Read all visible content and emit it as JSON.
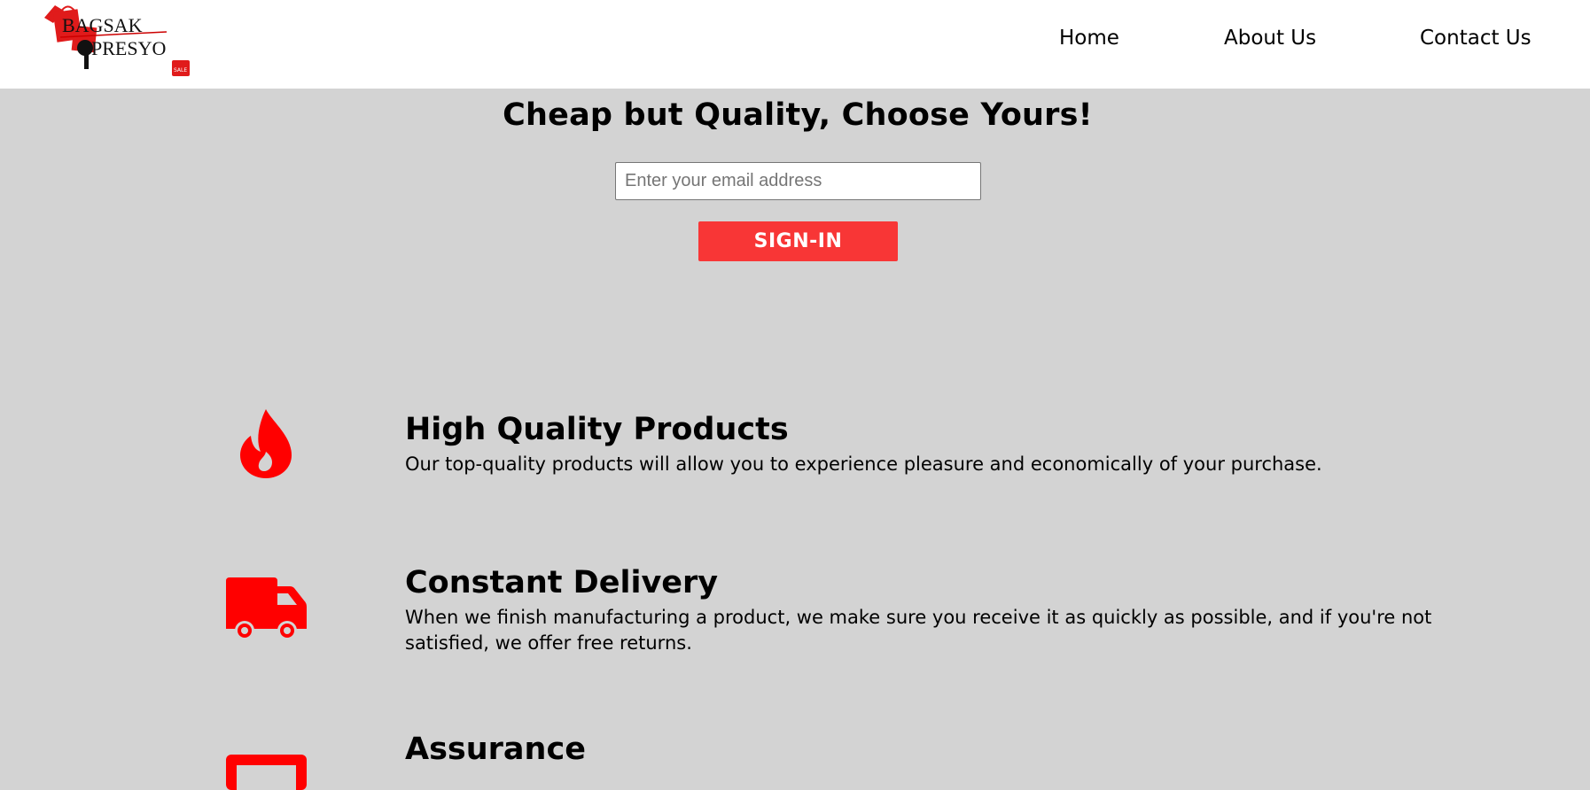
{
  "header": {
    "logo": {
      "line1": "BAGSAK",
      "line2": "PRESYO",
      "tag": "SALE"
    },
    "nav": [
      {
        "label": "Home"
      },
      {
        "label": "About Us"
      },
      {
        "label": "Contact Us"
      }
    ]
  },
  "hero": {
    "title": "Cheap but Quality, Choose Yours!",
    "email_placeholder": "Enter your email address",
    "email_value": "",
    "signin_label": "SIGN-IN"
  },
  "features": [
    {
      "icon": "fire-icon",
      "title": "High Quality Products",
      "description": "Our top-quality products will allow you to experience pleasure and economically of your purchase."
    },
    {
      "icon": "truck-icon",
      "title": "Constant Delivery",
      "description": "When we finish manufacturing a product, we make sure you receive it as quickly as possible, and if you're not satisfied, we offer free returns."
    },
    {
      "icon": "credit-card-icon",
      "title": "Assurance",
      "description": ""
    }
  ],
  "colors": {
    "accent": "#f83636",
    "icon": "#ff0000",
    "background": "#d3d3d3",
    "header": "#ffffff"
  }
}
